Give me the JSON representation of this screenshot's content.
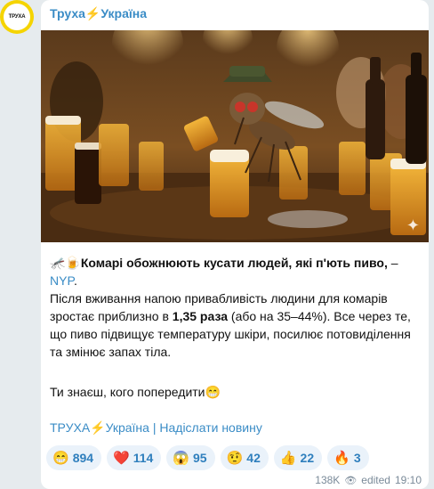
{
  "avatar": {
    "text": "ТРУХА"
  },
  "channel": {
    "name": "Труха⚡Україна"
  },
  "post": {
    "title_emoji": "🦟🍺",
    "title_bold": "Комарі обожнюють кусати людей, які п'ють пиво,",
    "title_dash": " – ",
    "title_link": "NYP",
    "title_end": ".",
    "p2_a": "Після вживання напою привабливість людини для комарів зростає приблизно в ",
    "p2_bold": "1,35 раза",
    "p2_b": " (або на 35–44%). Все через те, що пиво підвищує температуру шкіри, посилює потовиділення та змінює запах тіла.",
    "p3": "Ти знаєш, кого попередити😁",
    "footer_channel": "ТРУХА⚡Україна",
    "footer_sep": " | ",
    "footer_submit": "Надіслати новину"
  },
  "reactions": [
    {
      "emoji": "😁",
      "count": "894"
    },
    {
      "emoji": "❤️",
      "count": "114"
    },
    {
      "emoji": "😱",
      "count": "95"
    },
    {
      "emoji": "🤨",
      "count": "42"
    },
    {
      "emoji": "👍",
      "count": "22"
    },
    {
      "emoji": "🔥",
      "count": "3"
    }
  ],
  "meta": {
    "views": "138K",
    "edited": "edited",
    "time": "19:10"
  },
  "icons": {
    "views": "eye-icon",
    "photo_badge": "sparkle-icon"
  }
}
